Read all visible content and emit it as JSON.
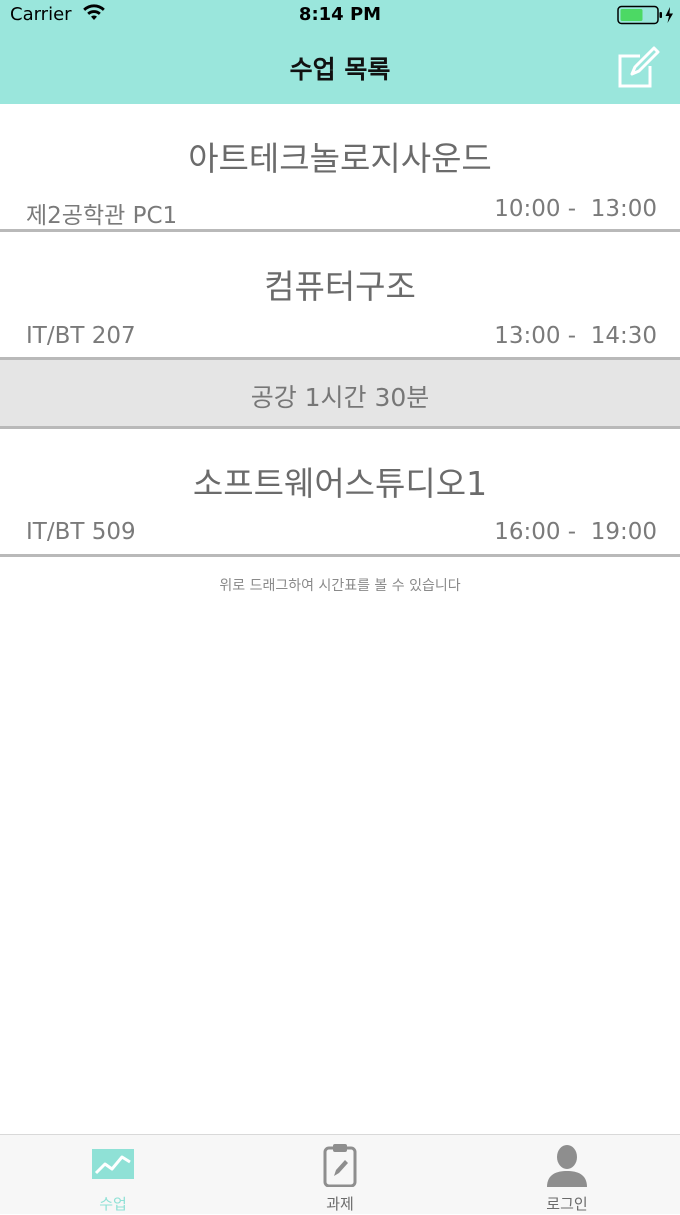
{
  "status_bar": {
    "carrier": "Carrier",
    "time": "8:14 PM",
    "icons": [
      "wifi-icon",
      "battery-icon",
      "charging-bolt-icon"
    ]
  },
  "nav": {
    "title": "수업 목록",
    "right_icon": "compose-icon"
  },
  "classes": [
    {
      "name": "아트테크놀로지사운드",
      "room": "제2공학관 PC1",
      "time": "10:00 -  13:00"
    },
    {
      "name": "컴퓨터구조",
      "room": "IT/BT 207",
      "time": "13:00 -  14:30"
    },
    {
      "name": "소프트웨어스튜디오1",
      "room": "IT/BT 509",
      "time": "16:00 -  19:00"
    }
  ],
  "gap": {
    "label": "공강 1시간 30분"
  },
  "hint": "위로 드래그하여 시간표를 볼 수 있습니다",
  "tabs": [
    {
      "label": "수업",
      "icon": "chart-icon",
      "active": true
    },
    {
      "label": "과제",
      "icon": "clipboard-icon",
      "active": false
    },
    {
      "label": "로그인",
      "icon": "person-icon",
      "active": false
    }
  ],
  "colors": {
    "header_bg": "#9ae6dc",
    "active_tab": "#8fe1d6",
    "gap_bg": "#e5e5e5",
    "separator": "#b9b9b9"
  }
}
